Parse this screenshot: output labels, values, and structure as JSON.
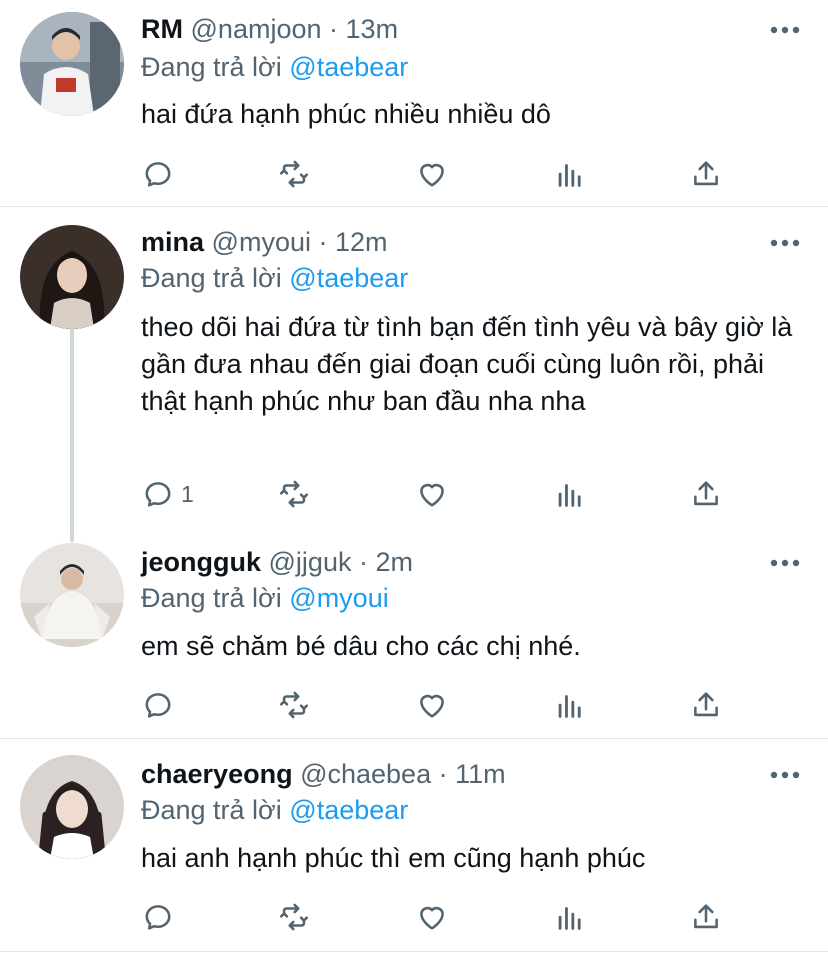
{
  "tweets": [
    {
      "name": "RM",
      "handle": "@namjoon",
      "sep": "·",
      "time": "13m",
      "replying_prefix": "Đang trả lời",
      "replying_to": "@taebear",
      "text": "hai đứa hạnh phúc nhiều nhiều dô",
      "reply_count": ""
    },
    {
      "name": "mina",
      "handle": "@myoui",
      "sep": "·",
      "time": "12m",
      "replying_prefix": "Đang trả lời",
      "replying_to": "@taebear",
      "text": "theo dõi hai đứa từ tình bạn đến tình yêu và bây giờ là gần đưa nhau đến giai đoạn cuối cùng luôn rồi, phải thật hạnh phúc như ban đầu nha nha",
      "reply_count": "1"
    },
    {
      "name": "jeongguk",
      "handle": "@jjguk",
      "sep": "·",
      "time": "2m",
      "replying_prefix": "Đang trả lời",
      "replying_to": "@myoui",
      "text": "em sẽ chăm bé dâu cho các chị nhé.",
      "reply_count": ""
    },
    {
      "name": "chaeryeong",
      "handle": "@chaebea",
      "sep": "·",
      "time": "11m",
      "replying_prefix": "Đang trả lời",
      "replying_to": "@taebear",
      "text": "hai anh hạnh phúc thì em cũng hạnh phúc",
      "reply_count": ""
    }
  ],
  "icons": {
    "reply": "reply-icon",
    "retweet": "retweet-icon",
    "like": "like-icon",
    "views": "views-icon",
    "share": "share-icon",
    "more": "more-icon"
  },
  "colors": {
    "link": "#1d9bf0",
    "secondary": "#536471",
    "primary": "#0f1419",
    "divider": "#e1e8ed"
  }
}
